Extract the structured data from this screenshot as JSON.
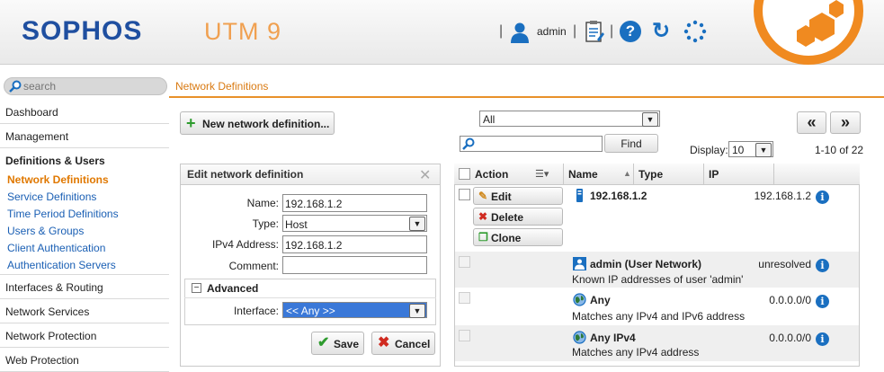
{
  "header": {
    "logo": "SOPHOS",
    "product": "UTM 9",
    "separator": "|",
    "user": "admin"
  },
  "sidebar": {
    "search_placeholder": "search",
    "items": [
      {
        "label": "Dashboard"
      },
      {
        "label": "Management"
      },
      {
        "label": "Definitions & Users"
      },
      {
        "label": "Interfaces & Routing"
      },
      {
        "label": "Network Services"
      },
      {
        "label": "Network Protection"
      },
      {
        "label": "Web Protection"
      }
    ],
    "subitems": [
      {
        "label": "Network Definitions",
        "active": true
      },
      {
        "label": "Service Definitions"
      },
      {
        "label": "Time Period Definitions"
      },
      {
        "label": "Users & Groups"
      },
      {
        "label": "Client Authentication"
      },
      {
        "label": "Authentication Servers"
      }
    ]
  },
  "breadcrumb": "Network Definitions",
  "toolbar": {
    "new_button": "New network definition...",
    "filter_value": "All",
    "find_button": "Find",
    "display_label": "Display:",
    "display_value": "10",
    "prev": "«",
    "next": "»",
    "range": "1-10 of 22"
  },
  "edit": {
    "title": "Edit network definition",
    "close": "✕",
    "fields": {
      "name_label": "Name:",
      "name_value": "192.168.1.2",
      "type_label": "Type:",
      "type_value": "Host",
      "ipv4_label": "IPv4 Address:",
      "ipv4_value": "192.168.1.2",
      "comment_label": "Comment:",
      "comment_value": ""
    },
    "advanced_toggle": "−",
    "advanced_label": "Advanced",
    "interface_label": "Interface:",
    "interface_value": "<< Any >>",
    "save": "Save",
    "cancel": "Cancel"
  },
  "table": {
    "columns": [
      "Action",
      "Name",
      "Type",
      "IP"
    ],
    "row_buttons": {
      "edit": "Edit",
      "delete": "Delete",
      "clone": "Clone"
    },
    "rows": [
      {
        "name": "192.168.1.2",
        "desc": "",
        "ip": "192.168.1.2"
      },
      {
        "name": "admin (User Network)",
        "desc": "Known IP addresses of user 'admin'",
        "ip": "unresolved"
      },
      {
        "name": "Any",
        "desc": "Matches any IPv4 and IPv6 address",
        "ip": "0.0.0.0/0"
      },
      {
        "name": "Any IPv4",
        "desc": "Matches any IPv4 address",
        "ip": "0.0.0.0/0"
      }
    ]
  },
  "colors": {
    "accent": "#e8912a",
    "brand_blue": "#1f4fa0",
    "link_blue": "#1a5fb4",
    "selection_blue": "#3a78d8"
  }
}
